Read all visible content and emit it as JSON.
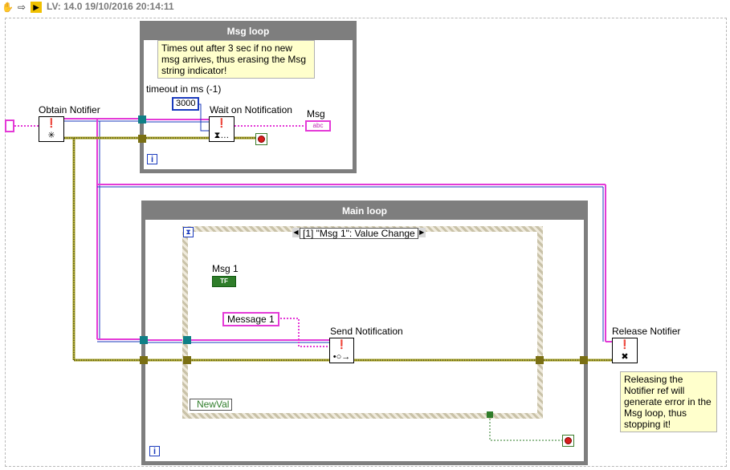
{
  "titlebar": {
    "text": "LV: 14.0 19/10/2016 20:14:11",
    "icons": [
      "hand-icon",
      "arrow-icon",
      "labview-icon"
    ]
  },
  "msg_loop": {
    "title": "Msg loop",
    "note": "Times out after 3 sec if no new msg arrives, thus erasing the Msg string indicator!",
    "timeout_label": "timeout in ms (-1)",
    "timeout_value": "3000",
    "wait_label": "Wait on Notification",
    "msg_label": "Msg",
    "msg_indicator_text": "abc",
    "iteration_label": "i"
  },
  "obtain": {
    "label": "Obtain Notifier"
  },
  "main_loop": {
    "title": "Main loop",
    "case_selector": "[1] \"Msg 1\": Value Change",
    "msg1_label": "Msg 1",
    "msg1_indicator_text": "TF",
    "message_const": "Message 1",
    "send_label": "Send Notification",
    "newval_label": "NewVal",
    "iteration_label": "i"
  },
  "release": {
    "label": "Release Notifier",
    "note": "Releasing the Notifier ref will generate error in the Msg loop, thus stopping it!"
  },
  "colors": {
    "loop_border": "#7e7e7e",
    "refnum_wire": "#e43ad7",
    "error_wire": "#a29d1f",
    "bool_wire": "#2f7d2a",
    "num_wire": "#1b3bbd",
    "note_bg": "#ffffcc"
  }
}
